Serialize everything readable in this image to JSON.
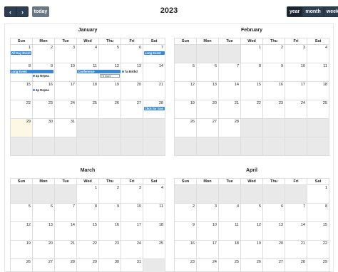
{
  "toolbar": {
    "prev_icon": "chevron-left-icon",
    "next_icon": "chevron-right-icon",
    "prev_glyph": "‹",
    "next_glyph": "›",
    "today_label": "today",
    "title": "2023",
    "views": [
      "year",
      "month",
      "week"
    ],
    "active_view": "year"
  },
  "weekday_headers": [
    "Sun",
    "Mon",
    "Tue",
    "Wed",
    "Thu",
    "Fri",
    "Sat"
  ],
  "months": [
    {
      "name": "January",
      "weeks": [
        [
          "1",
          "2",
          "3",
          "4",
          "5",
          "6",
          "7"
        ],
        [
          "8",
          "9",
          "10",
          "11",
          "12",
          "13",
          "14"
        ],
        [
          "15",
          "16",
          "17",
          "18",
          "19",
          "20",
          "21"
        ],
        [
          "22",
          "23",
          "24",
          "25",
          "26",
          "27",
          "28"
        ],
        [
          "29",
          "30",
          "31",
          "",
          "",
          "",
          ""
        ],
        [
          "",
          "",
          "",
          "",
          "",
          "",
          ""
        ]
      ],
      "events": {
        "all_day_event": "All Day Event",
        "long_event_top": "Long Event",
        "long_event": "Long Event",
        "repeating_1": "4p Repea",
        "conference": "Conference",
        "more": "+5 more",
        "birthday": "7a Birthd",
        "repeating_2": "4p Repea",
        "click_for_google": "Click for Goo"
      }
    },
    {
      "name": "February",
      "weeks": [
        [
          "",
          "",
          "",
          "1",
          "2",
          "3",
          "4"
        ],
        [
          "5",
          "6",
          "7",
          "8",
          "9",
          "10",
          "11"
        ],
        [
          "12",
          "13",
          "14",
          "15",
          "16",
          "17",
          "18"
        ],
        [
          "19",
          "20",
          "21",
          "22",
          "23",
          "24",
          "25"
        ],
        [
          "26",
          "27",
          "28",
          "",
          "",
          "",
          ""
        ],
        [
          "",
          "",
          "",
          "",
          "",
          "",
          ""
        ]
      ]
    },
    {
      "name": "March",
      "weeks": [
        [
          "",
          "",
          "",
          "1",
          "2",
          "3",
          "4"
        ],
        [
          "5",
          "6",
          "7",
          "8",
          "9",
          "10",
          "11"
        ],
        [
          "12",
          "13",
          "14",
          "15",
          "16",
          "17",
          "18"
        ],
        [
          "19",
          "20",
          "21",
          "22",
          "23",
          "24",
          "25"
        ],
        [
          "26",
          "27",
          "28",
          "29",
          "30",
          "31",
          ""
        ]
      ]
    },
    {
      "name": "April",
      "weeks": [
        [
          "",
          "",
          "",
          "",
          "",
          "",
          "1"
        ],
        [
          "2",
          "3",
          "4",
          "5",
          "6",
          "7",
          "8"
        ],
        [
          "9",
          "10",
          "11",
          "12",
          "13",
          "14",
          "15"
        ],
        [
          "16",
          "17",
          "18",
          "19",
          "20",
          "21",
          "22"
        ],
        [
          "23",
          "24",
          "25",
          "26",
          "27",
          "28",
          "29"
        ]
      ]
    }
  ]
}
